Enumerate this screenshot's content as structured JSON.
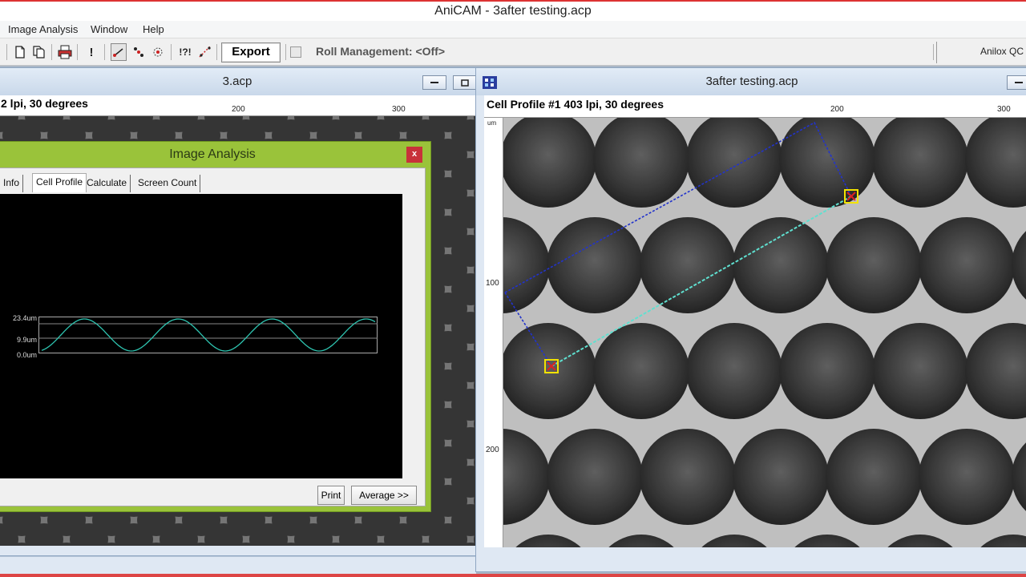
{
  "app": {
    "title": "AniCAM - 3after testing.acp"
  },
  "menu": {
    "items": [
      "Image Analysis",
      "Window",
      "Help"
    ]
  },
  "toolbar": {
    "export_label": "Export",
    "roll_management": "Roll Management: <Off>",
    "anilox_label": "Anilox QC",
    "icons": [
      "new-doc-icon",
      "copy-doc-icon",
      "print-icon",
      "alert-icon",
      "line-tool-icon",
      "cell-tool-icon",
      "cell-count-icon",
      "help-tool-icon",
      "measure-tool-icon"
    ]
  },
  "left_window": {
    "title": "3.acp",
    "profile_title": "2 lpi, 30 degrees",
    "ruler_ticks": [
      "200",
      "300"
    ]
  },
  "right_window": {
    "title": "3after testing.acp",
    "profile_title": "Cell Profile #1 403 lpi, 30 degrees",
    "ruler_ticks_h": [
      "200",
      "300"
    ],
    "ruler_ticks_v": [
      "um",
      "100",
      "200"
    ]
  },
  "dialog": {
    "title": "Image Analysis",
    "close_label": "x",
    "tabs": [
      "Info",
      "Cell Profile",
      "Calculate",
      "Screen Count"
    ],
    "active_tab": "Cell Profile",
    "graph_labels": [
      "23.4um",
      "9.9um",
      "0.0um"
    ],
    "print_label": "Print",
    "average_label": "Average >>"
  },
  "colors": {
    "dialog_frame": "#9ac33a",
    "profile_line": "#2ec4b0",
    "blue_dash": "#2233cc",
    "cyan_line": "#5fe0d0",
    "marker": "#f2e200"
  }
}
